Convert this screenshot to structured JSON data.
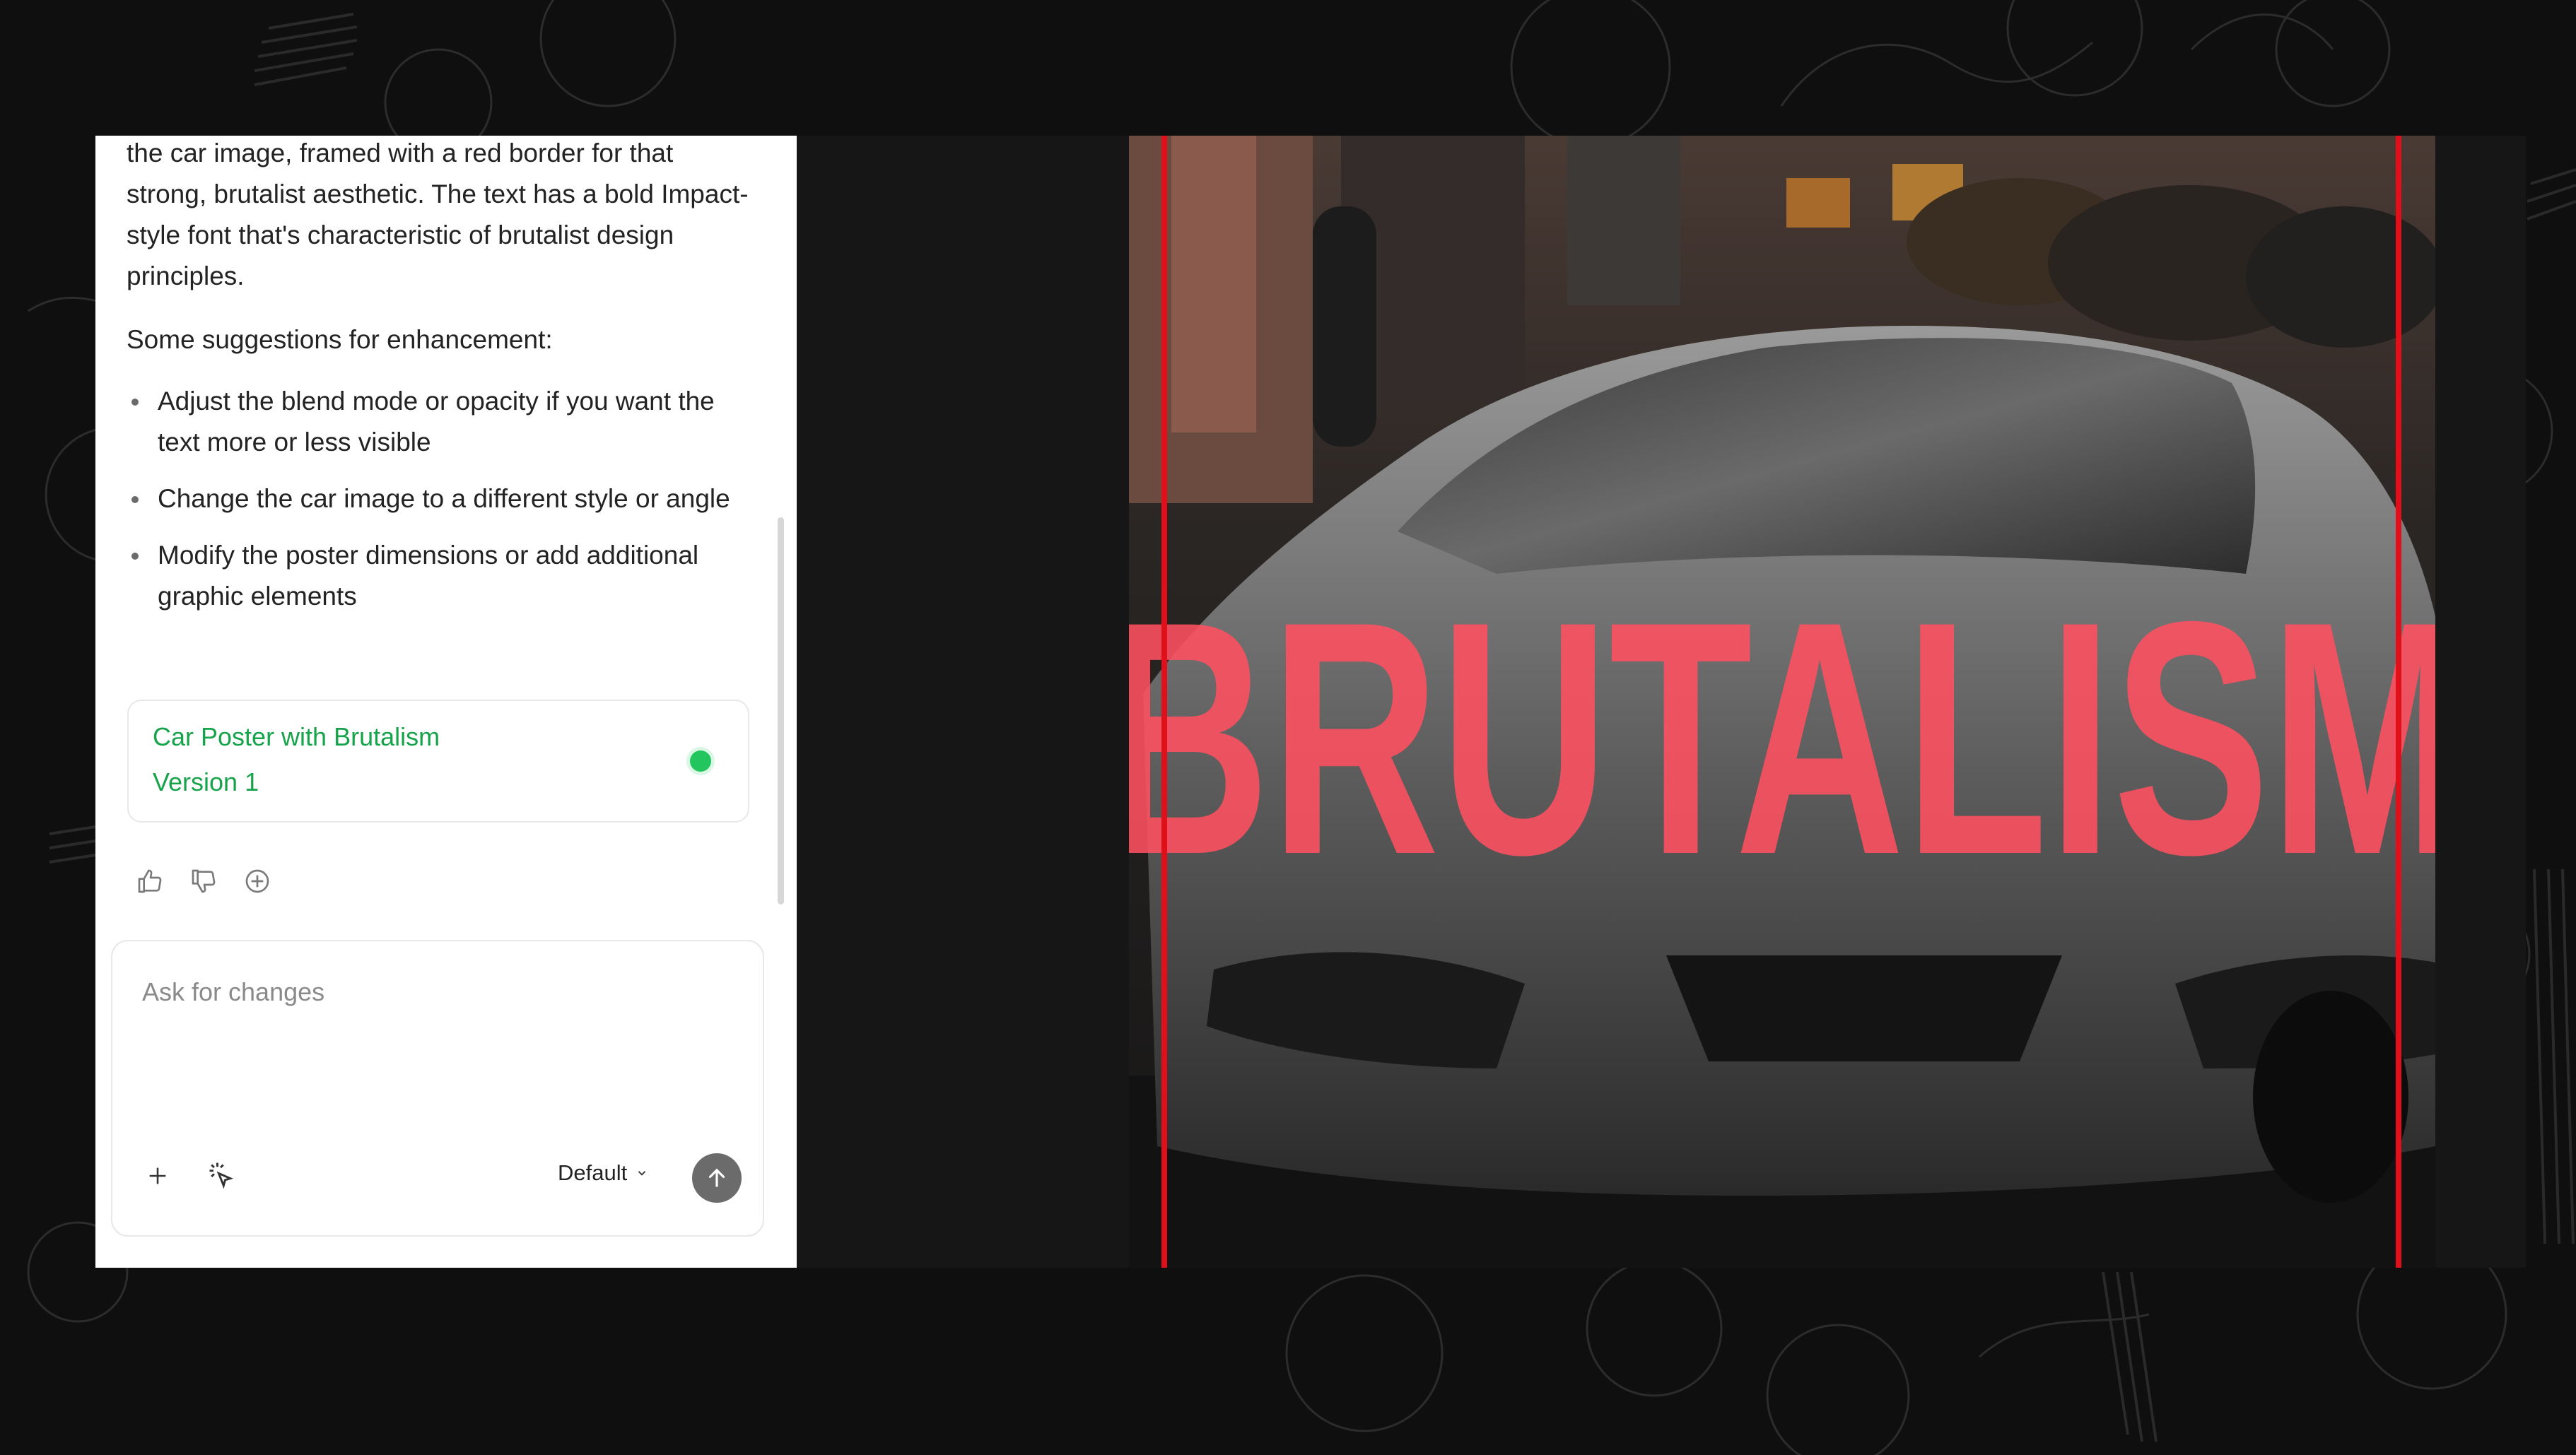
{
  "chat": {
    "intro_text": "the car image, framed with a red border for that strong, brutalist aesthetic. The text has a bold Impact-style font that's characteristic of brutalist design principles.",
    "suggestions_heading": "Some suggestions for enhancement:",
    "suggestions": [
      "Adjust the blend mode or opacity if you want the text more or less visible",
      "Change the car image to a different style or angle",
      "Modify the poster dimensions or add additional graphic elements"
    ],
    "artifact": {
      "title": "Car Poster with Brutalism",
      "version": "Version 1",
      "status_color": "#22c55e"
    },
    "feedback_icons": [
      "thumbs-up-icon",
      "thumbs-down-icon",
      "retry-icon"
    ]
  },
  "composer": {
    "placeholder": "Ask for changes",
    "value": "",
    "add_icon": "plus-icon",
    "select_icon": "cursor-select-icon",
    "model": "Default",
    "send_icon": "arrow-up-icon"
  },
  "poster": {
    "headline": "BRUTALISM",
    "border_color": "#e10f1a",
    "text_color": "#ff5060"
  },
  "theme": {
    "accent_green": "#16a34a",
    "background": "#0f0f0f",
    "preview_background": "#161616"
  }
}
